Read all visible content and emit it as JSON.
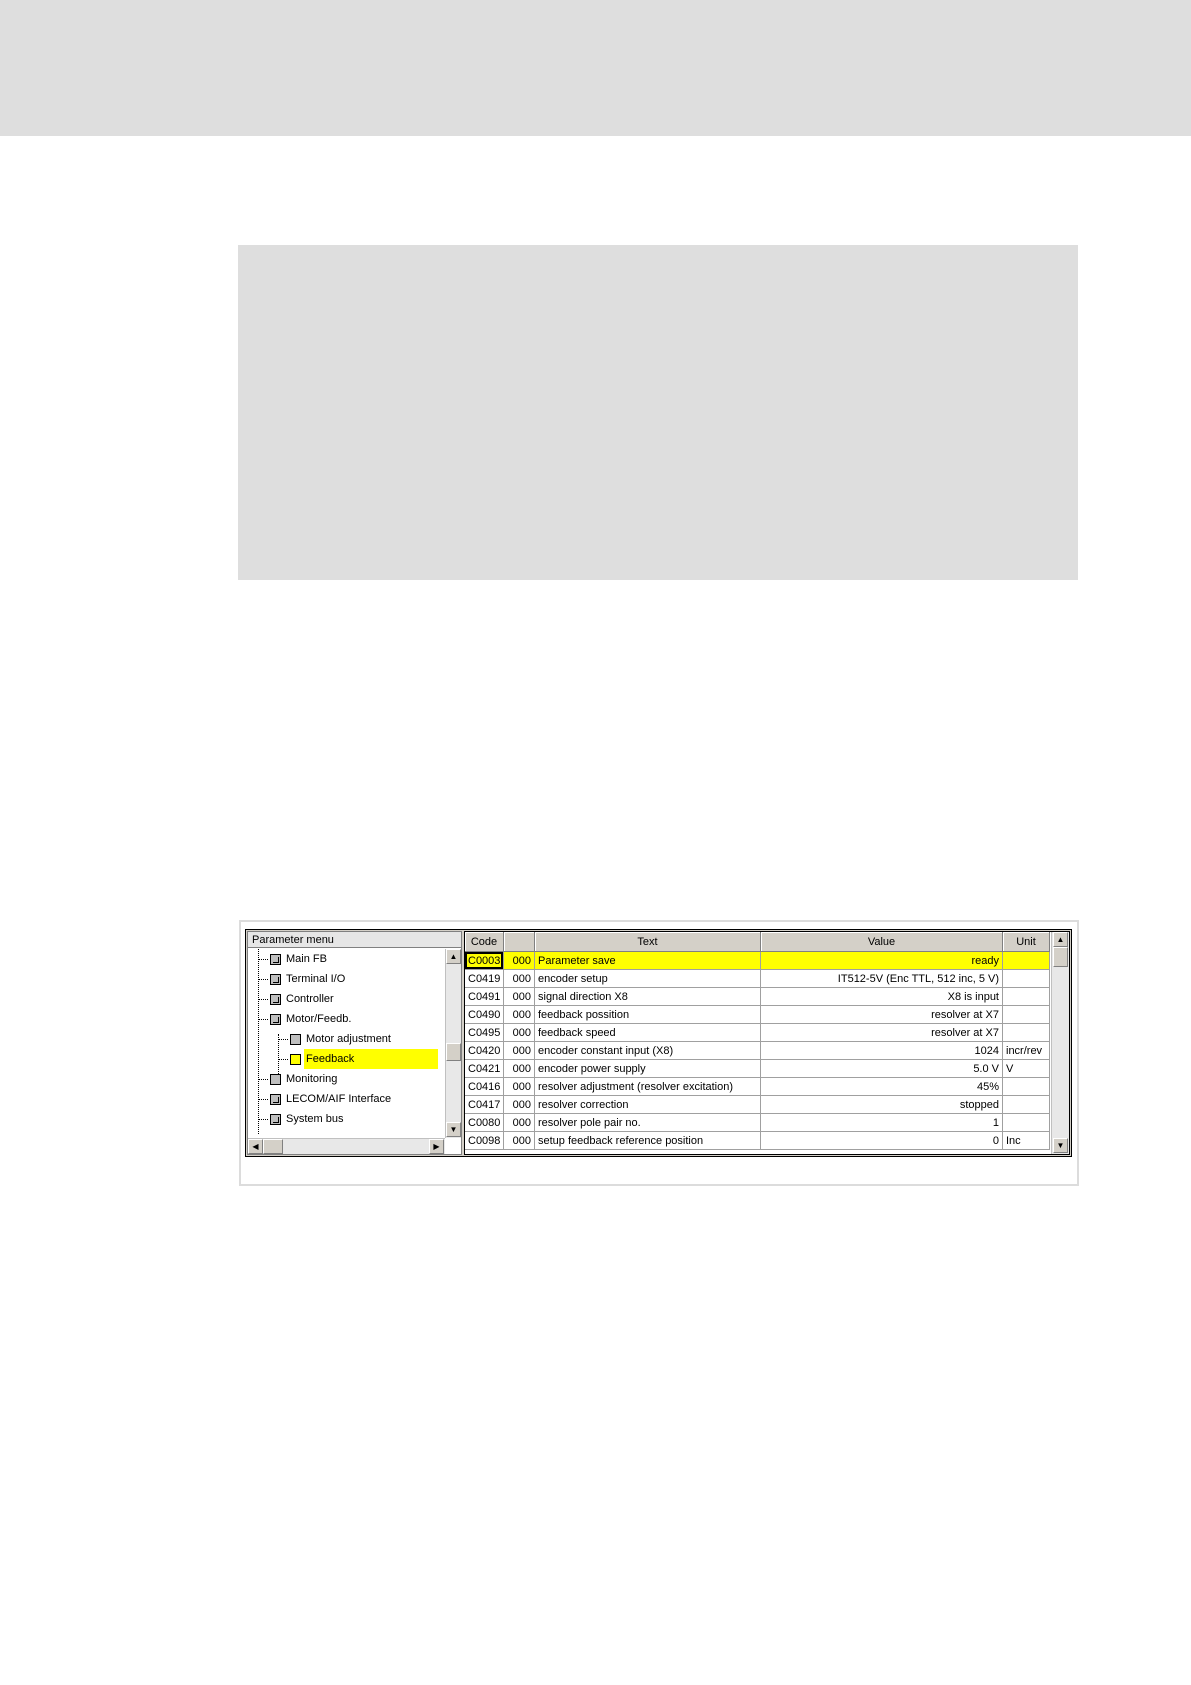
{
  "tree": {
    "header": "Parameter menu",
    "items": [
      {
        "label": "Main FB",
        "icon": "plus-book-icon"
      },
      {
        "label": "Terminal I/O",
        "icon": "plus-book-icon"
      },
      {
        "label": "Controller",
        "icon": "plus-book-icon"
      },
      {
        "label": "Motor/Feedb.",
        "icon": "minus-book-icon"
      },
      {
        "label": "Motor adjustment",
        "icon": "page-icon"
      },
      {
        "label": "Feedback",
        "icon": "arrow-page-icon",
        "selected": true
      },
      {
        "label": "Monitoring",
        "icon": "page-icon"
      },
      {
        "label": "LECOM/AIF Interface",
        "icon": "plus-book-icon"
      },
      {
        "label": "System bus",
        "icon": "plus-book-icon"
      }
    ]
  },
  "grid": {
    "headers": [
      "Code",
      "",
      "Text",
      "Value",
      "Unit"
    ],
    "rows": [
      {
        "code": "C0003",
        "sub": "000",
        "text": "Parameter save",
        "value": "ready",
        "unit": ""
      },
      {
        "code": "C0419",
        "sub": "000",
        "text": "encoder setup",
        "value": "IT512-5V  (Enc TTL,  512 inc, 5 V)",
        "unit": ""
      },
      {
        "code": "C0491",
        "sub": "000",
        "text": "signal direction X8",
        "value": "X8 is input",
        "unit": ""
      },
      {
        "code": "C0490",
        "sub": "000",
        "text": "feedback possition",
        "value": "resolver at X7",
        "unit": ""
      },
      {
        "code": "C0495",
        "sub": "000",
        "text": "feedback speed",
        "value": "resolver at X7",
        "unit": ""
      },
      {
        "code": "C0420",
        "sub": "000",
        "text": "encoder constant input (X8)",
        "value": "1024",
        "unit": "incr/rev"
      },
      {
        "code": "C0421",
        "sub": "000",
        "text": "encoder power supply",
        "value": "5.0 V",
        "unit": "V"
      },
      {
        "code": "C0416",
        "sub": "000",
        "text": "resolver adjustment (resolver excitation)",
        "value": "45%",
        "unit": ""
      },
      {
        "code": "C0417",
        "sub": "000",
        "text": "resolver correction",
        "value": "stopped",
        "unit": ""
      },
      {
        "code": "C0080",
        "sub": "000",
        "text": "resolver pole pair no.",
        "value": "1",
        "unit": ""
      },
      {
        "code": "C0098",
        "sub": "000",
        "text": " setup feedback reference position",
        "value": "0",
        "unit": "Inc"
      }
    ]
  },
  "colors": {
    "highlight": "#ffff00",
    "window_bg": "#d4d0c8"
  }
}
